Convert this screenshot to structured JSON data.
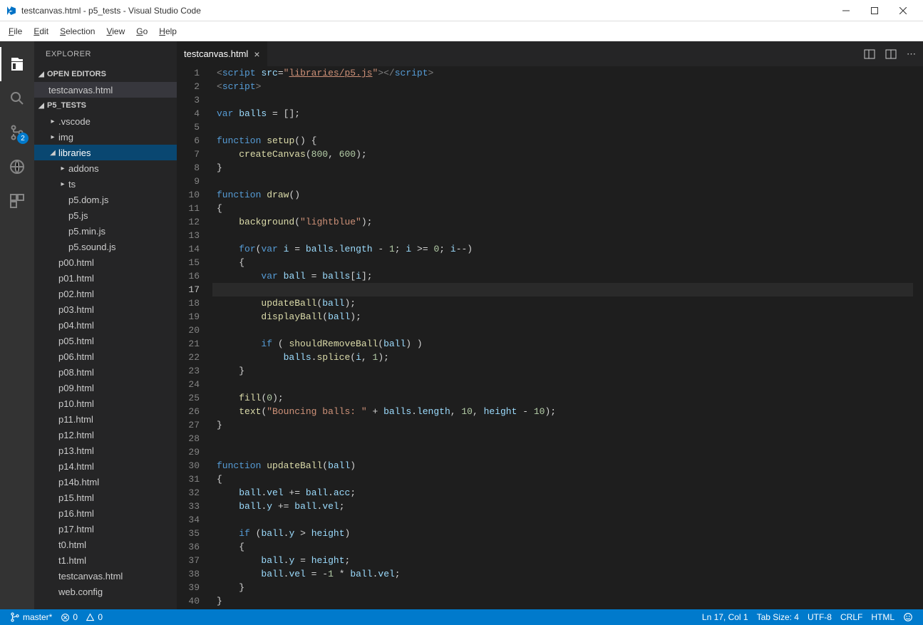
{
  "window": {
    "title": "testcanvas.html - p5_tests - Visual Studio Code"
  },
  "menubar": [
    "File",
    "Edit",
    "Selection",
    "View",
    "Go",
    "Help"
  ],
  "activitybar": {
    "badge_scm": "2"
  },
  "sidebar": {
    "title": "EXPLORER",
    "openEditors": {
      "label": "OPEN EDITORS",
      "items": [
        "testcanvas.html"
      ]
    },
    "project": {
      "label": "P5_TESTS",
      "tree": [
        {
          "type": "folder",
          "name": ".vscode",
          "depth": 1,
          "expanded": false
        },
        {
          "type": "folder",
          "name": "img",
          "depth": 1,
          "expanded": false
        },
        {
          "type": "folder",
          "name": "libraries",
          "depth": 1,
          "expanded": true,
          "selected": true
        },
        {
          "type": "folder",
          "name": "addons",
          "depth": 2,
          "expanded": false
        },
        {
          "type": "folder",
          "name": "ts",
          "depth": 2,
          "expanded": false
        },
        {
          "type": "file",
          "name": "p5.dom.js",
          "depth": 2
        },
        {
          "type": "file",
          "name": "p5.js",
          "depth": 2
        },
        {
          "type": "file",
          "name": "p5.min.js",
          "depth": 2
        },
        {
          "type": "file",
          "name": "p5.sound.js",
          "depth": 2
        },
        {
          "type": "file",
          "name": "p00.html",
          "depth": 1
        },
        {
          "type": "file",
          "name": "p01.html",
          "depth": 1
        },
        {
          "type": "file",
          "name": "p02.html",
          "depth": 1
        },
        {
          "type": "file",
          "name": "p03.html",
          "depth": 1
        },
        {
          "type": "file",
          "name": "p04.html",
          "depth": 1
        },
        {
          "type": "file",
          "name": "p05.html",
          "depth": 1
        },
        {
          "type": "file",
          "name": "p06.html",
          "depth": 1
        },
        {
          "type": "file",
          "name": "p08.html",
          "depth": 1
        },
        {
          "type": "file",
          "name": "p09.html",
          "depth": 1
        },
        {
          "type": "file",
          "name": "p10.html",
          "depth": 1
        },
        {
          "type": "file",
          "name": "p11.html",
          "depth": 1
        },
        {
          "type": "file",
          "name": "p12.html",
          "depth": 1
        },
        {
          "type": "file",
          "name": "p13.html",
          "depth": 1
        },
        {
          "type": "file",
          "name": "p14.html",
          "depth": 1
        },
        {
          "type": "file",
          "name": "p14b.html",
          "depth": 1
        },
        {
          "type": "file",
          "name": "p15.html",
          "depth": 1
        },
        {
          "type": "file",
          "name": "p16.html",
          "depth": 1
        },
        {
          "type": "file",
          "name": "p17.html",
          "depth": 1
        },
        {
          "type": "file",
          "name": "t0.html",
          "depth": 1
        },
        {
          "type": "file",
          "name": "t1.html",
          "depth": 1
        },
        {
          "type": "file",
          "name": "testcanvas.html",
          "depth": 1
        },
        {
          "type": "file",
          "name": "web.config",
          "depth": 1
        }
      ]
    }
  },
  "tabs": [
    {
      "label": "testcanvas.html",
      "active": true
    }
  ],
  "editor": {
    "currentLine": 17,
    "lines": [
      {
        "n": 1,
        "html": "<span class='tok-pun'>&lt;</span><span class='tok-tag'>script</span> <span class='tok-attr'>src</span><span class='tok-op'>=</span><span class='tok-str'>\"</span><span class='tok-link'>libraries/p5.js</span><span class='tok-str'>\"</span><span class='tok-pun'>&gt;&lt;/</span><span class='tok-tag'>script</span><span class='tok-pun'>&gt;</span>"
      },
      {
        "n": 2,
        "html": "<span class='tok-pun'>&lt;</span><span class='tok-tag'>script</span><span class='tok-pun'>&gt;</span>"
      },
      {
        "n": 3,
        "html": ""
      },
      {
        "n": 4,
        "html": "<span class='tok-kw'>var</span> <span class='tok-var'>balls</span> <span class='tok-op'>=</span> [];"
      },
      {
        "n": 5,
        "html": ""
      },
      {
        "n": 6,
        "html": "<span class='tok-kw'>function</span> <span class='tok-fn'>setup</span>() {"
      },
      {
        "n": 7,
        "html": "    <span class='tok-fn'>createCanvas</span>(<span class='tok-num'>800</span>, <span class='tok-num'>600</span>);"
      },
      {
        "n": 8,
        "html": "}"
      },
      {
        "n": 9,
        "html": ""
      },
      {
        "n": 10,
        "html": "<span class='tok-kw'>function</span> <span class='tok-fn'>draw</span>()"
      },
      {
        "n": 11,
        "html": "{"
      },
      {
        "n": 12,
        "html": "    <span class='tok-fn'>background</span>(<span class='tok-str'>\"lightblue\"</span>);"
      },
      {
        "n": 13,
        "html": ""
      },
      {
        "n": 14,
        "html": "    <span class='tok-kw'>for</span>(<span class='tok-kw'>var</span> <span class='tok-var'>i</span> <span class='tok-op'>=</span> <span class='tok-var'>balls</span>.<span class='tok-var'>length</span> <span class='tok-op'>-</span> <span class='tok-num'>1</span>; <span class='tok-var'>i</span> <span class='tok-op'>&gt;=</span> <span class='tok-num'>0</span>; <span class='tok-var'>i</span><span class='tok-op'>--</span>)"
      },
      {
        "n": 15,
        "html": "    {"
      },
      {
        "n": 16,
        "html": "        <span class='tok-kw'>var</span> <span class='tok-var'>ball</span> <span class='tok-op'>=</span> <span class='tok-var'>balls</span>[<span class='tok-var'>i</span>];"
      },
      {
        "n": 17,
        "html": ""
      },
      {
        "n": 18,
        "html": "        <span class='tok-fn'>updateBall</span>(<span class='tok-var'>ball</span>);"
      },
      {
        "n": 19,
        "html": "        <span class='tok-fn'>displayBall</span>(<span class='tok-var'>ball</span>);"
      },
      {
        "n": 20,
        "html": ""
      },
      {
        "n": 21,
        "html": "        <span class='tok-kw'>if</span> ( <span class='tok-fn'>shouldRemoveBall</span>(<span class='tok-var'>ball</span>) )"
      },
      {
        "n": 22,
        "html": "            <span class='tok-var'>balls</span>.<span class='tok-fn'>splice</span>(<span class='tok-var'>i</span>, <span class='tok-num'>1</span>);"
      },
      {
        "n": 23,
        "html": "    }"
      },
      {
        "n": 24,
        "html": ""
      },
      {
        "n": 25,
        "html": "    <span class='tok-fn'>fill</span>(<span class='tok-num'>0</span>);"
      },
      {
        "n": 26,
        "html": "    <span class='tok-fn'>text</span>(<span class='tok-str'>\"Bouncing balls: \"</span> <span class='tok-op'>+</span> <span class='tok-var'>balls</span>.<span class='tok-var'>length</span>, <span class='tok-num'>10</span>, <span class='tok-var'>height</span> <span class='tok-op'>-</span> <span class='tok-num'>10</span>);"
      },
      {
        "n": 27,
        "html": "}"
      },
      {
        "n": 28,
        "html": ""
      },
      {
        "n": 29,
        "html": ""
      },
      {
        "n": 30,
        "html": "<span class='tok-kw'>function</span> <span class='tok-fn'>updateBall</span>(<span class='tok-var'>ball</span>)"
      },
      {
        "n": 31,
        "html": "{"
      },
      {
        "n": 32,
        "html": "    <span class='tok-var'>ball</span>.<span class='tok-var'>vel</span> <span class='tok-op'>+=</span> <span class='tok-var'>ball</span>.<span class='tok-var'>acc</span>;"
      },
      {
        "n": 33,
        "html": "    <span class='tok-var'>ball</span>.<span class='tok-var'>y</span> <span class='tok-op'>+=</span> <span class='tok-var'>ball</span>.<span class='tok-var'>vel</span>;"
      },
      {
        "n": 34,
        "html": ""
      },
      {
        "n": 35,
        "html": "    <span class='tok-kw'>if</span> (<span class='tok-var'>ball</span>.<span class='tok-var'>y</span> <span class='tok-op'>&gt;</span> <span class='tok-var'>height</span>)"
      },
      {
        "n": 36,
        "html": "    {"
      },
      {
        "n": 37,
        "html": "        <span class='tok-var'>ball</span>.<span class='tok-var'>y</span> <span class='tok-op'>=</span> <span class='tok-var'>height</span>;"
      },
      {
        "n": 38,
        "html": "        <span class='tok-var'>ball</span>.<span class='tok-var'>vel</span> <span class='tok-op'>=</span> <span class='tok-op'>-</span><span class='tok-num'>1</span> <span class='tok-op'>*</span> <span class='tok-var'>ball</span>.<span class='tok-var'>vel</span>;"
      },
      {
        "n": 39,
        "html": "    }"
      },
      {
        "n": 40,
        "html": "}"
      }
    ]
  },
  "statusbar": {
    "branch": "master*",
    "errors": "0",
    "warnings": "0",
    "position": "Ln 17, Col 1",
    "tabsize": "Tab Size: 4",
    "encoding": "UTF-8",
    "eol": "CRLF",
    "language": "HTML"
  }
}
